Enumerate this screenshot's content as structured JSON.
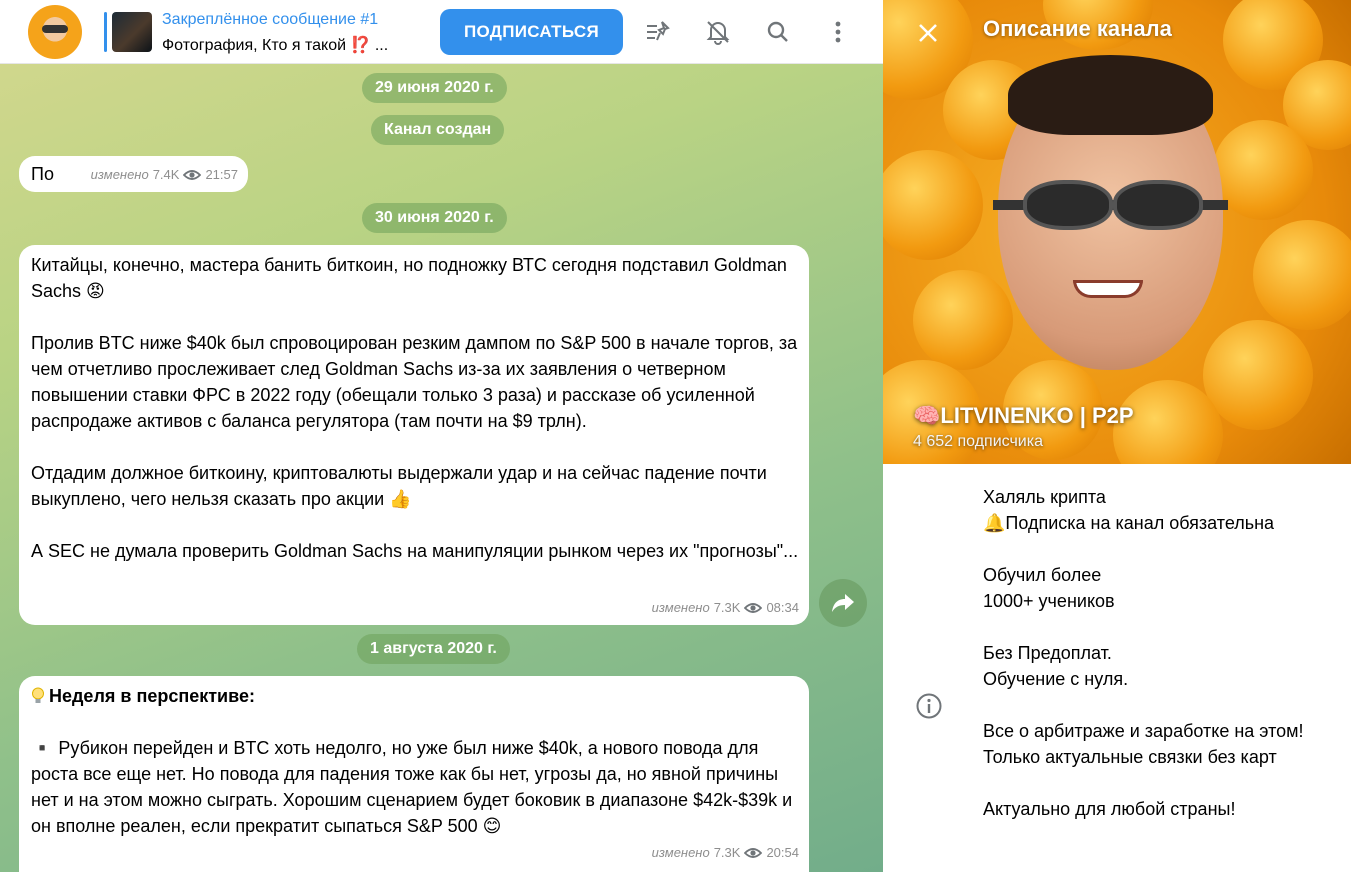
{
  "header": {
    "pinned_title": "Закреплённое сообщение #1",
    "pinned_text": "Фотография, Кто я такой ⁉️ ...",
    "subscribe_label": "ПОДПИСАТЬСЯ"
  },
  "chat": {
    "dates": [
      "29 июня 2020 г.",
      "30 июня 2020 г.",
      "1 августа 2020 г."
    ],
    "service_created": "Канал создан",
    "messages": [
      {
        "text": "По",
        "edited": "изменено",
        "views": "7.4K",
        "time": "21:57"
      },
      {
        "lines": [
          "Китайцы, конечно, мастера банить биткоин, но подножку ВТС сегодня подставил Goldman Sachs 😡",
          "",
          "Пролив BTC ниже $40k был спровоцирован резким дампом по S&P 500 в начале торгов, за чем отчетливо прослеживает след Goldman Sachs из-за их заявления о четверном повышении ставки ФРС в 2022 году (обещали только 3 раза) и рассказе об усиленной распродаже активов с баланса регулятора (там почти на $9 трлн).",
          "",
          "Отдадим должное биткоину, криптовалюты выдержали удар и на сейчас падение почти выкуплено, чего нельзя сказать про акции 👍",
          "",
          "А SEC не думала проверить Goldman Sachs на манипуляции рынком через их \"прогнозы\"..."
        ],
        "edited": "изменено",
        "views": "7.3K",
        "time": "08:34"
      },
      {
        "heading": "Неделя в перспективе:",
        "lines": [
          "▪️ Рубикон перейден и BTC хоть недолго, но уже был ниже $40k, а нового повода для роста все еще нет. Но повода для падения тоже как бы нет, угрозы да, но явной причины нет и на этом можно сыграть. Хорошим сценарием будет боковик в диапазоне $42k-$39k и он вполне реален, если прекратит сыпаться S&P 500 😊"
        ],
        "edited": "изменено",
        "views": "7.3K",
        "time": "20:54"
      }
    ]
  },
  "info": {
    "title": "Описание канала",
    "channel_name": "🧠LITVINENKO | P2P",
    "subscribers": "4 652 подписчика",
    "description": [
      "Халяль крипта",
      "🔔Подписка на канал обязательна",
      "",
      "Обучил более",
      "1000+ учеников",
      "",
      "Без Предоплат.",
      "Обучение с нуля.",
      "",
      "Все о арбитраже и заработке на этом!",
      "Только актуальные связки без карт",
      "",
      "Актуально для любой страны!"
    ]
  },
  "colors": {
    "accent": "#3390ec",
    "chat_bg": "#a9cc86",
    "bubble": "#ffffff"
  }
}
